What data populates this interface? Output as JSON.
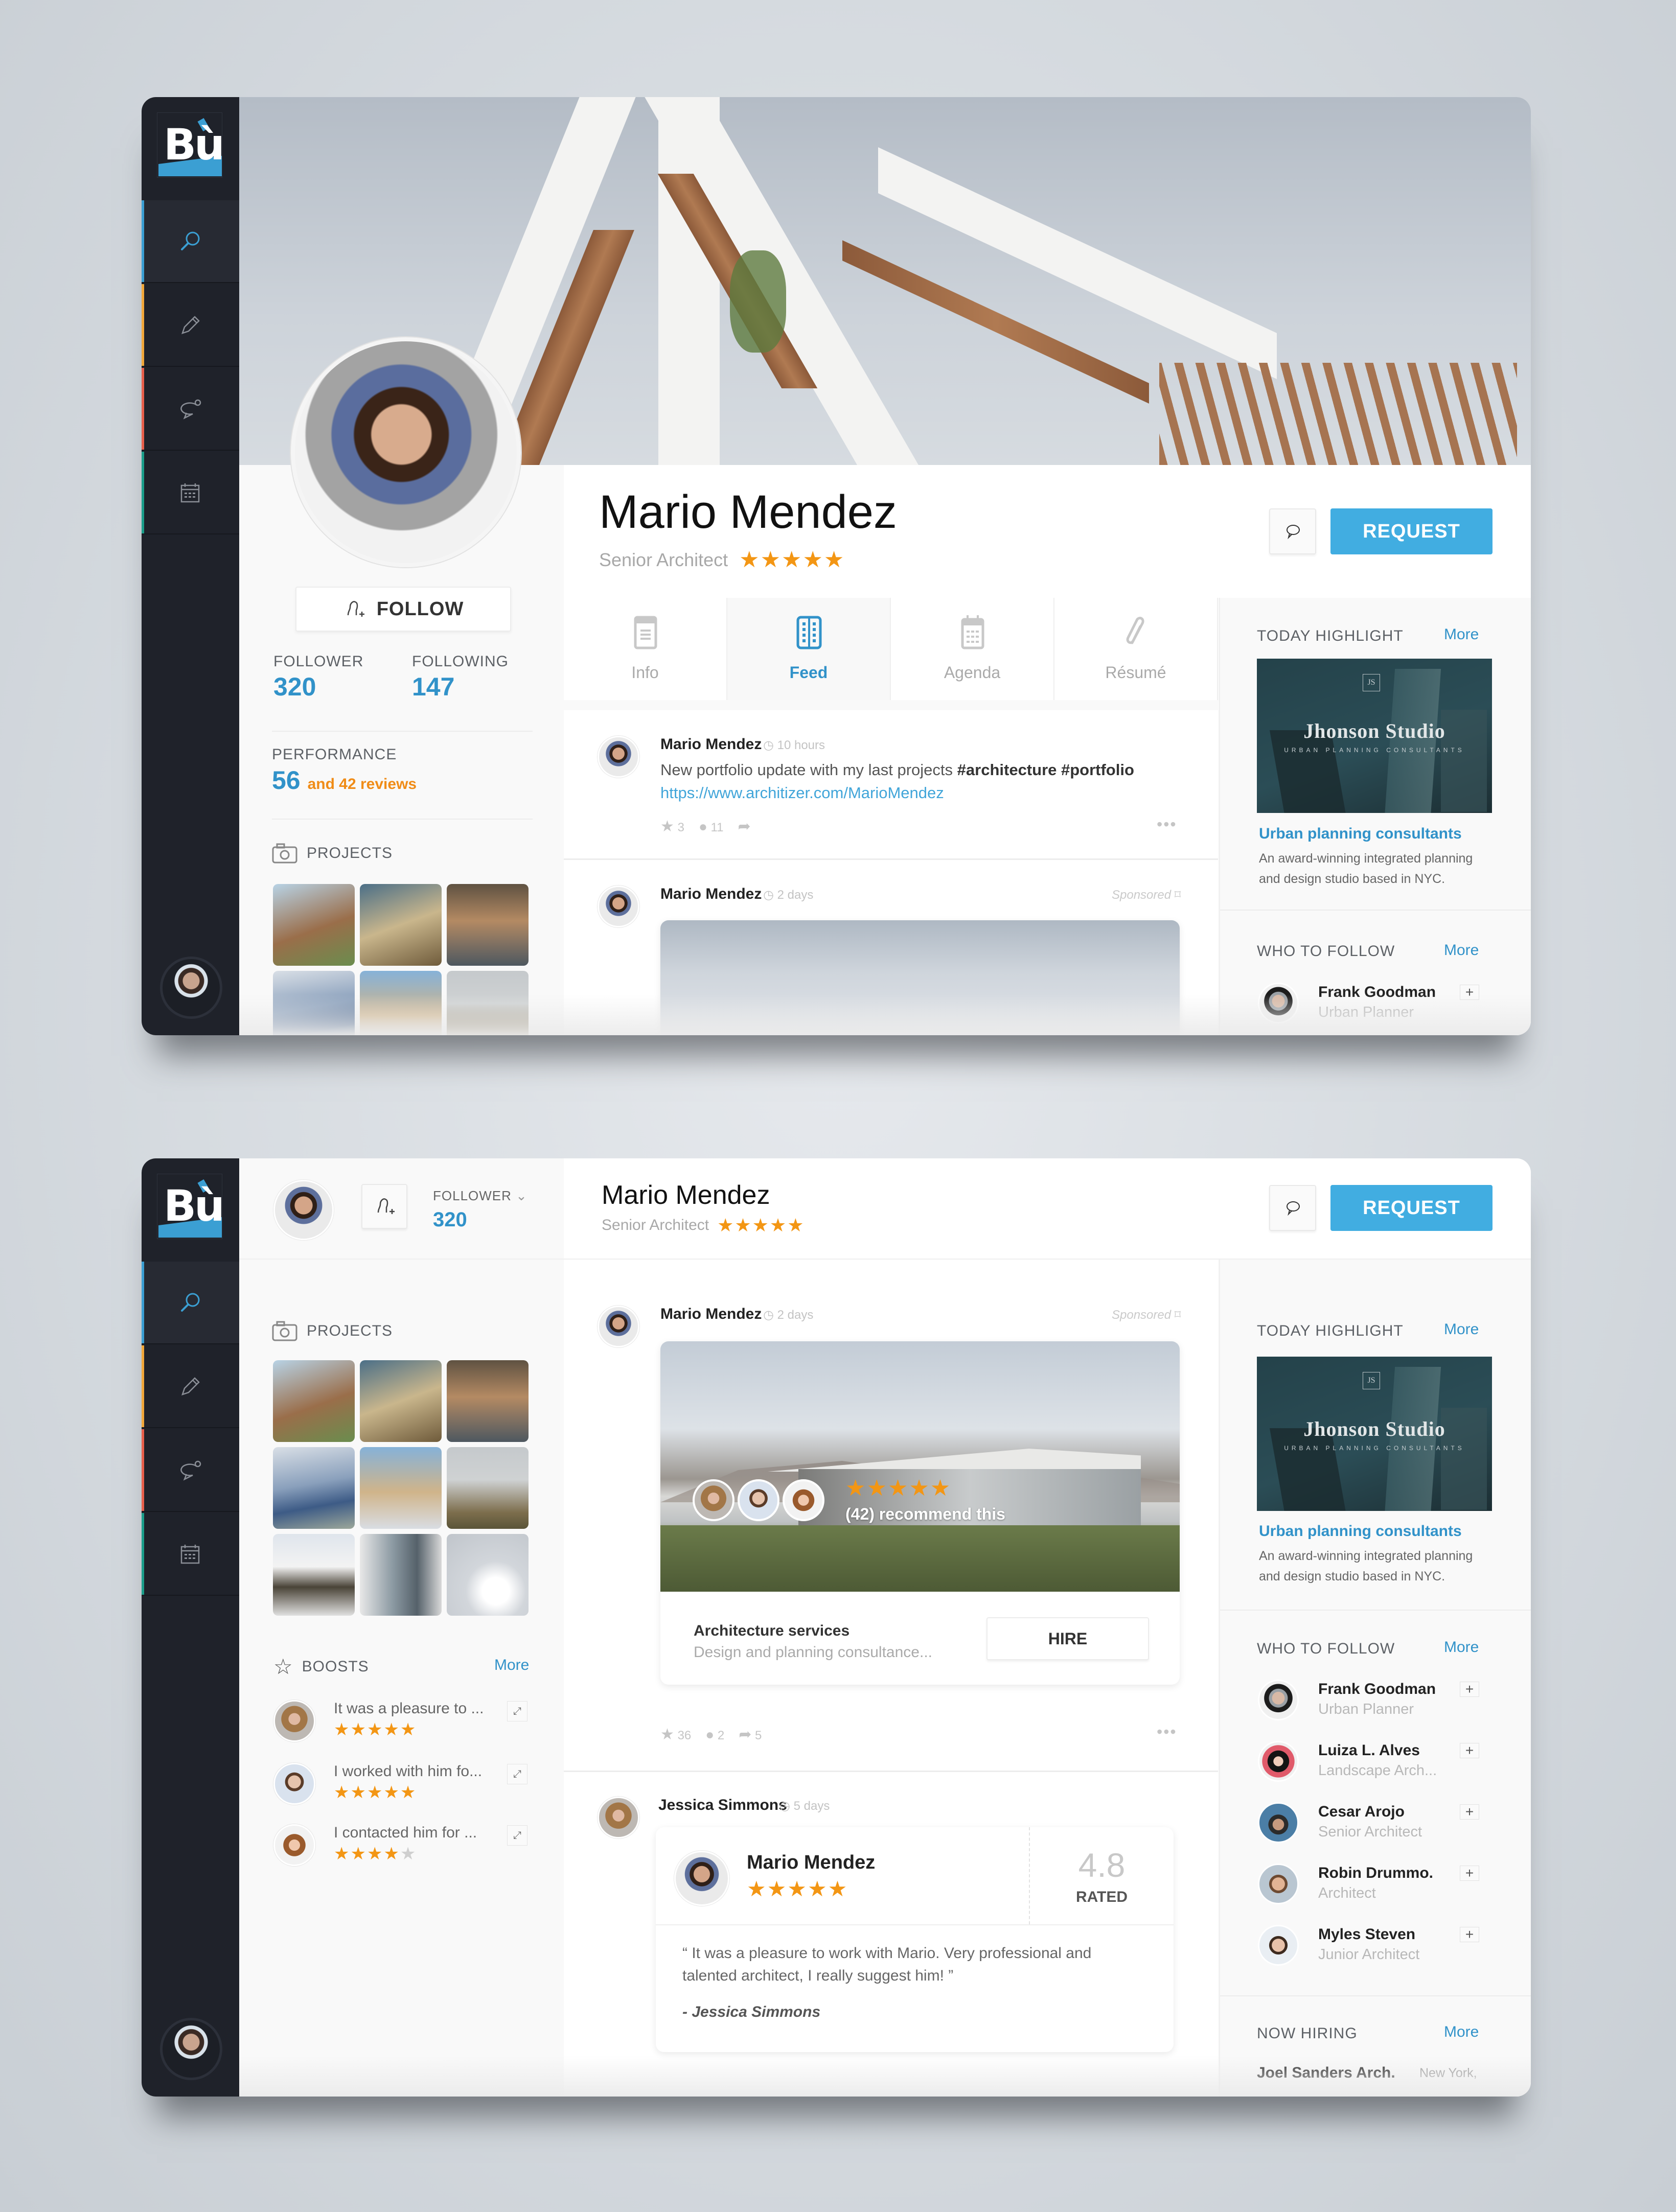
{
  "brand": {
    "logo_text": "Bù",
    "accent": "#41ade1",
    "star_color": "#f39614"
  },
  "sidebar": {
    "items": [
      {
        "name": "search",
        "icon": "search-icon",
        "color": "#3b9fd3",
        "active": true
      },
      {
        "name": "edit",
        "icon": "pencil-icon",
        "color": "#f2a83a",
        "active": false
      },
      {
        "name": "messages",
        "icon": "chat-bubble-icon",
        "color": "#e8604c",
        "active": false
      },
      {
        "name": "calendar",
        "icon": "calendar-icon",
        "color": "#1b9e8a",
        "active": false
      }
    ],
    "user_avatar": "current-user-avatar"
  },
  "profile": {
    "name": "Mario Mendez",
    "title": "Senior Architect",
    "rating_stars": "★★★★★",
    "follow_label": "FOLLOW",
    "follower_label": "FOLLOWER",
    "follower_count": "320",
    "following_label": "FOLLOWING",
    "following_count": "147",
    "performance_label": "PERFORMANCE",
    "performance_value": "56",
    "performance_reviews": "and 42 reviews",
    "projects_label": "PROJECTS",
    "request_label": "REQUEST"
  },
  "tabs": [
    {
      "label": "Info",
      "icon": "clipboard-icon",
      "active": false
    },
    {
      "label": "Feed",
      "icon": "book-icon",
      "active": true
    },
    {
      "label": "Agenda",
      "icon": "calendar-icon",
      "active": false
    },
    {
      "label": "Résumé",
      "icon": "paperclip-icon",
      "active": false
    }
  ],
  "feed": {
    "post1": {
      "author": "Mario Mendez",
      "time": "10 hours",
      "text": "New portfolio update with my last projects",
      "hashtags": "#architecture #portfolio",
      "link": "https://www.architizer.com/MarioMendez",
      "stars": "3",
      "comments": "11"
    },
    "post2": {
      "author": "Mario Mendez",
      "time": "2 days",
      "sponsored": "Sponsored",
      "recommend_stars": "★★★★★",
      "recommend_text": "(42) recommend this",
      "service_title": "Architecture services",
      "service_desc": "Design and planning consultance...",
      "hire_label": "HIRE",
      "stars": "36",
      "comments": "2",
      "shares": "5"
    },
    "post3": {
      "author": "Jessica Simmons",
      "time": "5 days",
      "reviewed_name": "Mario Mendez",
      "reviewed_stars": "★★★★★",
      "rating": "4.8",
      "rated_label": "RATED",
      "quote": "“ It was a pleasure to work with Mario. Very professional and talented architect, I really suggest him! ”",
      "signature": "- Jessica Simmons"
    }
  },
  "right": {
    "highlight_label": "TODAY HIGHLIGHT",
    "more_label": "More",
    "highlight_logo": "JS",
    "highlight_brand": "Jhonson Studio",
    "highlight_tagline": "URBAN PLANNING CONSULTANTS",
    "highlight_title": "Urban planning consultants",
    "highlight_desc": "An award-winning integrated planning and design studio based in NYC.",
    "who_to_follow_label": "WHO TO FOLLOW",
    "who_to_follow": [
      {
        "name": "Frank Goodman",
        "role": "Urban Planner"
      },
      {
        "name": "Luiza L. Alves",
        "role": "Landscape Arch..."
      },
      {
        "name": "Cesar Arojo",
        "role": "Senior Architect"
      },
      {
        "name": "Robin Drummo.",
        "role": "Architect"
      },
      {
        "name": "Myles Steven",
        "role": "Junior Architect"
      }
    ],
    "now_hiring_label": "NOW HIRING",
    "hiring": [
      {
        "company": "Joel Sanders Arch.",
        "location": "New York,"
      }
    ]
  },
  "boosts": {
    "label": "BOOSTS",
    "more_label": "More",
    "items": [
      {
        "text": "It was a pleasure to ...",
        "rating": 5,
        "stars_on": "★★★★★",
        "stars_off": ""
      },
      {
        "text": "I worked with him fo...",
        "rating": 5,
        "stars_on": "★★★★★",
        "stars_off": ""
      },
      {
        "text": "I contacted him for ...",
        "rating": 4,
        "stars_on": "★★★★",
        "stars_off": "★"
      }
    ]
  },
  "icons": {
    "plus": "+",
    "expand": "⤢",
    "more_dots": "•••",
    "chevron": "⌄"
  }
}
